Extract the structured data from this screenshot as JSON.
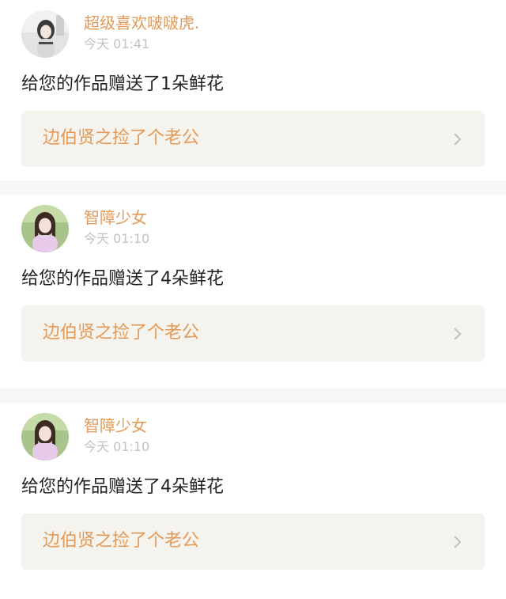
{
  "notifications": [
    {
      "username": "超级喜欢啵啵虎.",
      "time": "今天 01:41",
      "message": "给您的作品赠送了1朵鲜花",
      "work_title": "边伯贤之捡了个老公",
      "avatar_icon": "user-avatar-photo"
    },
    {
      "username": "智障少女",
      "time": "今天 01:10",
      "message": "给您的作品赠送了4朵鲜花",
      "work_title": "边伯贤之捡了个老公",
      "avatar_icon": "user-avatar-photo"
    },
    {
      "username": "智障少女",
      "time": "今天 01:10",
      "message": "给您的作品赠送了4朵鲜花",
      "work_title": "边伯贤之捡了个老公",
      "avatar_icon": "user-avatar-photo"
    }
  ],
  "colors": {
    "accent": "#e39a58",
    "timestamp": "#c2c2c2",
    "message": "#222222",
    "link_background": "#f4f3ed",
    "divider": "#f7f7f7",
    "chevron": "#bfbfbf"
  },
  "icons": {
    "chevron": "chevron-right-icon"
  }
}
